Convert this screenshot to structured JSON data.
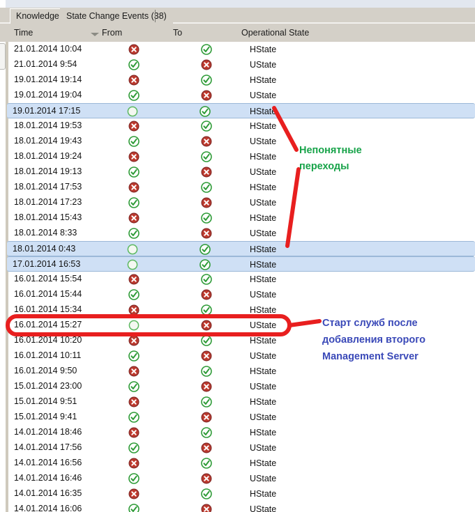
{
  "window": {
    "title": "State Change Events"
  },
  "tabs": [
    {
      "label": "Knowledge",
      "active": false
    },
    {
      "label": "State Change Events (38)",
      "active": true
    }
  ],
  "columns": [
    {
      "label": "Time",
      "sorted": true,
      "sort_direction": "descending"
    },
    {
      "label": "From",
      "sorted": false
    },
    {
      "label": "To",
      "sorted": false
    },
    {
      "label": "Operational State",
      "sorted": false
    }
  ],
  "icons": {
    "critical": "red-x-circle-icon",
    "healthy": "green-check-circle-icon",
    "uninitialized": "green-empty-circle-icon"
  },
  "colors": {
    "critical": "#c0392b",
    "healthy": "#2e9b37",
    "uninitialized": "#5cb860",
    "selection": "#cfe0f5",
    "chrome": "#d4d0c8",
    "annotation_green": "#17a349",
    "annotation_blue": "#3a49b8",
    "annotation_red": "#e81f1f"
  },
  "rows": [
    {
      "time": "21.01.2014 10:04",
      "from": "critical",
      "to": "healthy",
      "state": "HState",
      "selected": false
    },
    {
      "time": "21.01.2014 9:54",
      "from": "healthy",
      "to": "critical",
      "state": "UState",
      "selected": false
    },
    {
      "time": "19.01.2014 19:14",
      "from": "critical",
      "to": "healthy",
      "state": "HState",
      "selected": false
    },
    {
      "time": "19.01.2014 19:04",
      "from": "healthy",
      "to": "critical",
      "state": "UState",
      "selected": false
    },
    {
      "time": "19.01.2014 17:15",
      "from": "uninitialized",
      "to": "healthy",
      "state": "HState",
      "selected": true
    },
    {
      "time": "18.01.2014 19:53",
      "from": "critical",
      "to": "healthy",
      "state": "HState",
      "selected": false
    },
    {
      "time": "18.01.2014 19:43",
      "from": "healthy",
      "to": "critical",
      "state": "UState",
      "selected": false
    },
    {
      "time": "18.01.2014 19:24",
      "from": "critical",
      "to": "healthy",
      "state": "HState",
      "selected": false
    },
    {
      "time": "18.01.2014 19:13",
      "from": "healthy",
      "to": "critical",
      "state": "UState",
      "selected": false
    },
    {
      "time": "18.01.2014 17:53",
      "from": "critical",
      "to": "healthy",
      "state": "HState",
      "selected": false
    },
    {
      "time": "18.01.2014 17:23",
      "from": "healthy",
      "to": "critical",
      "state": "UState",
      "selected": false
    },
    {
      "time": "18.01.2014 15:43",
      "from": "critical",
      "to": "healthy",
      "state": "HState",
      "selected": false
    },
    {
      "time": "18.01.2014 8:33",
      "from": "healthy",
      "to": "critical",
      "state": "UState",
      "selected": false
    },
    {
      "time": "18.01.2014 0:43",
      "from": "uninitialized",
      "to": "healthy",
      "state": "HState",
      "selected": true
    },
    {
      "time": "17.01.2014 16:53",
      "from": "uninitialized",
      "to": "healthy",
      "state": "HState",
      "selected": true
    },
    {
      "time": "16.01.2014 15:54",
      "from": "critical",
      "to": "healthy",
      "state": "HState",
      "selected": false
    },
    {
      "time": "16.01.2014 15:44",
      "from": "healthy",
      "to": "critical",
      "state": "UState",
      "selected": false
    },
    {
      "time": "16.01.2014 15:34",
      "from": "critical",
      "to": "healthy",
      "state": "HState",
      "selected": false
    },
    {
      "time": "16.01.2014 15:27",
      "from": "uninitialized",
      "to": "critical",
      "state": "UState",
      "selected": false
    },
    {
      "time": "16.01.2014 10:20",
      "from": "critical",
      "to": "healthy",
      "state": "HState",
      "selected": false
    },
    {
      "time": "16.01.2014 10:11",
      "from": "healthy",
      "to": "critical",
      "state": "UState",
      "selected": false
    },
    {
      "time": "16.01.2014 9:50",
      "from": "critical",
      "to": "healthy",
      "state": "HState",
      "selected": false
    },
    {
      "time": "15.01.2014 23:00",
      "from": "healthy",
      "to": "critical",
      "state": "UState",
      "selected": false
    },
    {
      "time": "15.01.2014 9:51",
      "from": "critical",
      "to": "healthy",
      "state": "HState",
      "selected": false
    },
    {
      "time": "15.01.2014 9:41",
      "from": "healthy",
      "to": "critical",
      "state": "UState",
      "selected": false
    },
    {
      "time": "14.01.2014 18:46",
      "from": "critical",
      "to": "healthy",
      "state": "HState",
      "selected": false
    },
    {
      "time": "14.01.2014 17:56",
      "from": "healthy",
      "to": "critical",
      "state": "UState",
      "selected": false
    },
    {
      "time": "14.01.2014 16:56",
      "from": "critical",
      "to": "healthy",
      "state": "HState",
      "selected": false
    },
    {
      "time": "14.01.2014 16:46",
      "from": "healthy",
      "to": "critical",
      "state": "UState",
      "selected": false
    },
    {
      "time": "14.01.2014 16:35",
      "from": "critical",
      "to": "healthy",
      "state": "HState",
      "selected": false
    },
    {
      "time": "14.01.2014 16:06",
      "from": "healthy",
      "to": "critical",
      "state": "UState",
      "selected": false
    }
  ],
  "annotations": {
    "green_note": "Непонятные\nпереходы",
    "blue_note": "Старт служб после\nдобавления второго\nManagement Server"
  }
}
